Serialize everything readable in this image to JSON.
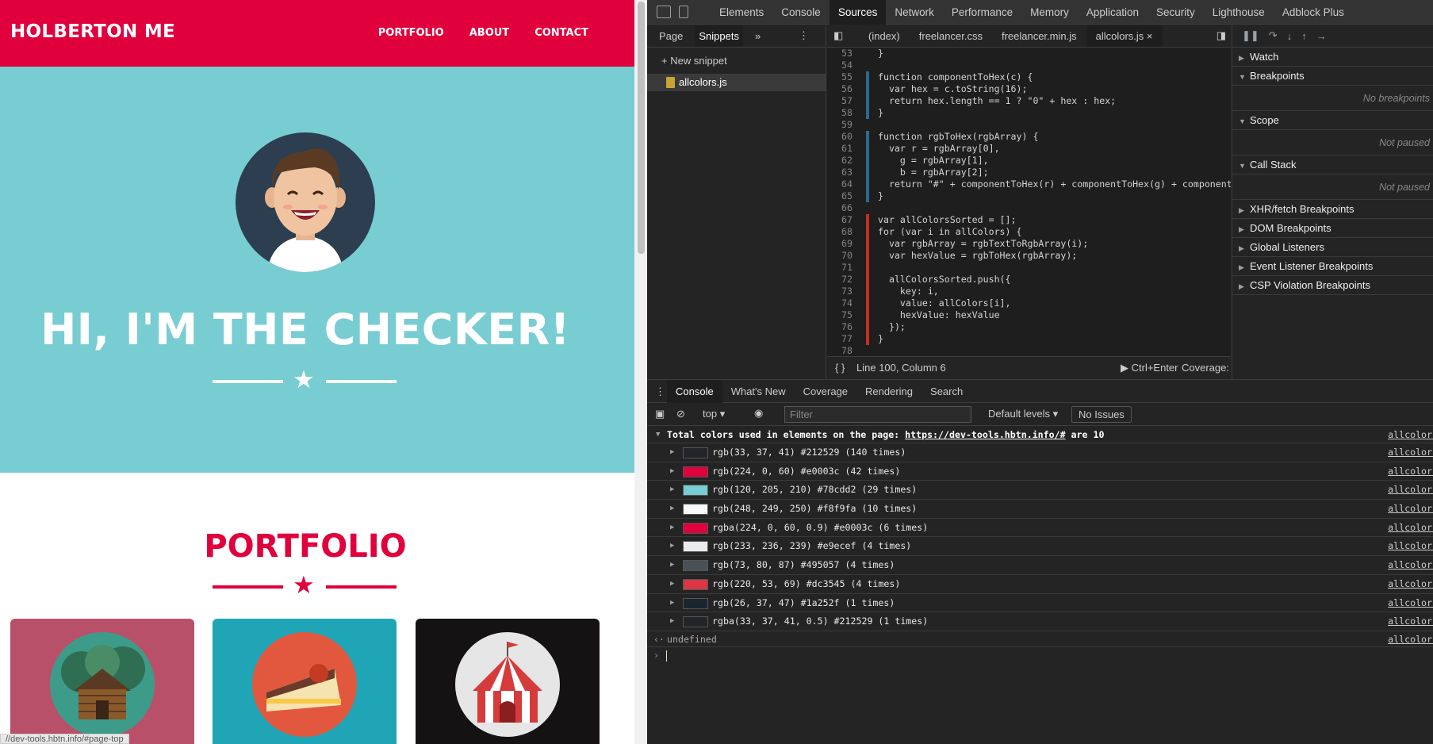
{
  "site": {
    "brand": "HOLBERTON ME",
    "nav": [
      "PORTFOLIO",
      "ABOUT",
      "CONTACT"
    ],
    "hero_title": "HI, I'M THE CHECKER!",
    "portfolio_title": "PORTFOLIO",
    "status_url": "//dev-tools.hbtn.info/#page-top",
    "colors": {
      "primary": "#e0003c",
      "hero": "#78cdd2",
      "dark": "#212529"
    }
  },
  "devtools": {
    "main_tabs": [
      "Elements",
      "Console",
      "Sources",
      "Network",
      "Performance",
      "Memory",
      "Application",
      "Security",
      "Lighthouse",
      "Adblock Plus"
    ],
    "active_main_tab": "Sources",
    "nav_tabs": [
      "Page",
      "Snippets"
    ],
    "new_snippet": "New snippet",
    "snippet_file": "allcolors.js",
    "editor_tabs": [
      "(index)",
      "freelancer.css",
      "freelancer.min.js",
      "allcolors.js"
    ],
    "code_lines": [
      {
        "n": "53",
        "t": "}"
      },
      {
        "n": "54",
        "t": ""
      },
      {
        "n": "55",
        "t": "function componentToHex(c) {"
      },
      {
        "n": "56",
        "t": "  var hex = c.toString(16);"
      },
      {
        "n": "57",
        "t": "  return hex.length == 1 ? \"0\" + hex : hex;"
      },
      {
        "n": "58",
        "t": "}"
      },
      {
        "n": "59",
        "t": ""
      },
      {
        "n": "60",
        "t": "function rgbToHex(rgbArray) {"
      },
      {
        "n": "61",
        "t": "  var r = rgbArray[0],"
      },
      {
        "n": "62",
        "t": "    g = rgbArray[1],"
      },
      {
        "n": "63",
        "t": "    b = rgbArray[2];"
      },
      {
        "n": "64",
        "t": "  return \"#\" + componentToHex(r) + componentToHex(g) + componentToHex(b"
      },
      {
        "n": "65",
        "t": "}"
      },
      {
        "n": "66",
        "t": ""
      },
      {
        "n": "67",
        "t": "var allColorsSorted = [];"
      },
      {
        "n": "68",
        "t": "for (var i in allColors) {"
      },
      {
        "n": "69",
        "t": "  var rgbArray = rgbTextToRgbArray(i);"
      },
      {
        "n": "70",
        "t": "  var hexValue = rgbToHex(rgbArray);"
      },
      {
        "n": "71",
        "t": ""
      },
      {
        "n": "72",
        "t": "  allColorsSorted.push({"
      },
      {
        "n": "73",
        "t": "    key: i,"
      },
      {
        "n": "74",
        "t": "    value: allColors[i],"
      },
      {
        "n": "75",
        "t": "    hexValue: hexValue"
      },
      {
        "n": "76",
        "t": "  });"
      },
      {
        "n": "77",
        "t": "}"
      },
      {
        "n": "78",
        "t": ""
      }
    ],
    "status_position": "Line 100, Column 6",
    "run_shortcut": "Ctrl+Enter",
    "coverage": "Coverage: n/a",
    "debugger_sections": [
      {
        "label": "Watch",
        "open": false
      },
      {
        "label": "Breakpoints",
        "open": true,
        "note": "No breakpoints"
      },
      {
        "label": "Scope",
        "open": true,
        "note": "Not paused"
      },
      {
        "label": "Call Stack",
        "open": true,
        "note": "Not paused"
      },
      {
        "label": "XHR/fetch Breakpoints",
        "open": false
      },
      {
        "label": "DOM Breakpoints",
        "open": false
      },
      {
        "label": "Global Listeners",
        "open": false
      },
      {
        "label": "Event Listener Breakpoints",
        "open": false
      },
      {
        "label": "CSP Violation Breakpoints",
        "open": false
      }
    ],
    "drawer_tabs": [
      "Console",
      "What's New",
      "Coverage",
      "Rendering",
      "Search"
    ],
    "context": "top",
    "filter_placeholder": "Filter",
    "levels": "Default levels",
    "issues": "No Issues",
    "summary_prefix": "Total colors used in elements on the page: ",
    "summary_link": "https://dev-tools.hbtn.info/#",
    "summary_suffix": " are 10",
    "source_link": "allcolors",
    "colors": [
      {
        "text": "rgb(33, 37, 41) #212529 (140 times)",
        "swatch": "#212529"
      },
      {
        "text": "rgb(224, 0, 60) #e0003c (42 times)",
        "swatch": "#e0003c"
      },
      {
        "text": "rgb(120, 205, 210) #78cdd2 (29 times)",
        "swatch": "#78cdd2"
      },
      {
        "text": "rgb(248, 249, 250) #f8f9fa (10 times)",
        "swatch": "#f8f9fa"
      },
      {
        "text": "rgba(224, 0, 60, 0.9) #e0003c (6 times)",
        "swatch": "#e0003c"
      },
      {
        "text": "rgb(233, 236, 239) #e9ecef (4 times)",
        "swatch": "#e9ecef"
      },
      {
        "text": "rgb(73, 80, 87) #495057 (4 times)",
        "swatch": "#495057"
      },
      {
        "text": "rgb(220, 53, 69) #dc3545 (4 times)",
        "swatch": "#dc3545"
      },
      {
        "text": "rgb(26, 37, 47) #1a252f (1 times)",
        "swatch": "#1a252f"
      },
      {
        "text": "rgba(33, 37, 41, 0.5) #212529 (1 times)",
        "swatch": "#212529"
      }
    ],
    "return_value": "undefined"
  }
}
